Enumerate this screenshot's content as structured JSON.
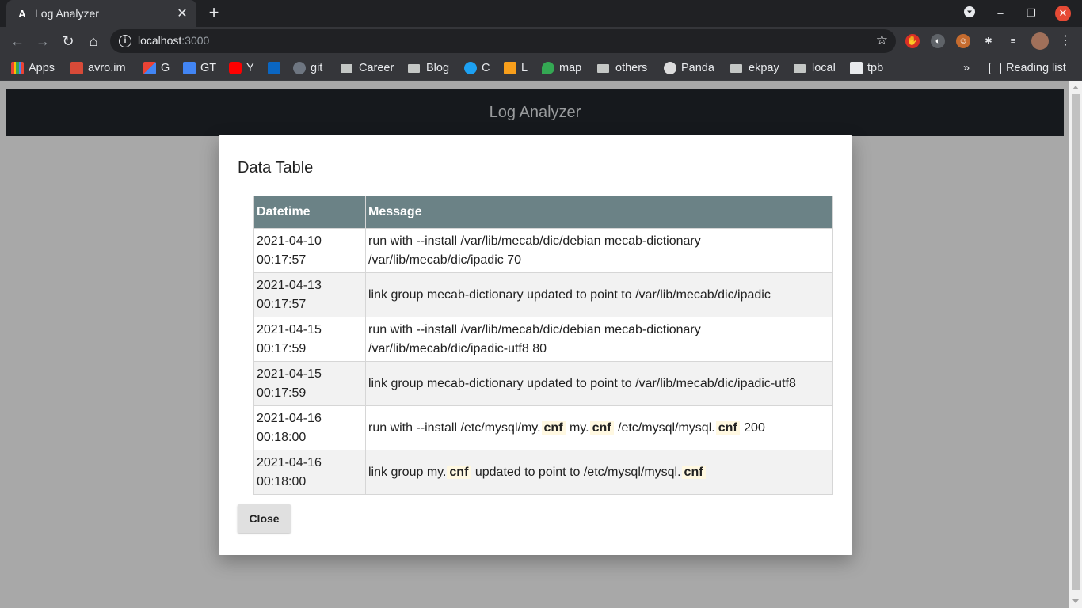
{
  "browser": {
    "tab_title": "Log Analyzer",
    "tab_favicon": "A",
    "url_host": "localhost",
    "url_port": ":3000",
    "bookmarks": [
      {
        "label": "Apps",
        "icon": "apps-grid-icon"
      },
      {
        "label": "avro.im",
        "icon": "avro-icon"
      },
      {
        "label": "G",
        "icon": "gmail-icon"
      },
      {
        "label": "GT",
        "icon": "google-translate-icon"
      },
      {
        "label": "Y",
        "icon": "youtube-icon"
      },
      {
        "label": "",
        "icon": "linkedin-icon"
      },
      {
        "label": "git",
        "icon": "github-icon"
      },
      {
        "label": "Career",
        "icon": "folder-icon"
      },
      {
        "label": "Blog",
        "icon": "folder-icon"
      },
      {
        "label": "C",
        "icon": "circle-icon"
      },
      {
        "label": "L",
        "icon": "leetcode-icon"
      },
      {
        "label": "map",
        "icon": "maps-pin-icon"
      },
      {
        "label": "others",
        "icon": "folder-icon"
      },
      {
        "label": "Panda",
        "icon": "panda-icon"
      },
      {
        "label": "ekpay",
        "icon": "folder-icon"
      },
      {
        "label": "local",
        "icon": "folder-icon"
      },
      {
        "label": "tpb",
        "icon": "tpb-icon"
      }
    ],
    "overflow_label": "»",
    "reading_list_label": "Reading list"
  },
  "app": {
    "header_title": "Log Analyzer"
  },
  "modal": {
    "title": "Data Table",
    "columns": [
      "Datetime",
      "Message"
    ],
    "rows": [
      {
        "date": "2021-04-10",
        "time": "00:17:57",
        "message": [
          {
            "text": "run with --install /var/lib/mecab/dic/debian mecab-dictionary /var/lib/mecab/dic/ipadic 70",
            "hl": false
          }
        ]
      },
      {
        "date": "2021-04-13",
        "time": "00:17:57",
        "message": [
          {
            "text": "link group mecab-dictionary updated to point to /var/lib/mecab/dic/ipadic",
            "hl": false
          }
        ]
      },
      {
        "date": "2021-04-15",
        "time": "00:17:59",
        "message": [
          {
            "text": "run with --install /var/lib/mecab/dic/debian mecab-dictionary /var/lib/mecab/dic/ipadic-utf8 80",
            "hl": false
          }
        ]
      },
      {
        "date": "2021-04-15",
        "time": "00:17:59",
        "message": [
          {
            "text": "link group mecab-dictionary updated to point to /var/lib/mecab/dic/ipadic-utf8",
            "hl": false
          }
        ]
      },
      {
        "date": "2021-04-16",
        "time": "00:18:00",
        "message": [
          {
            "text": "run with --install /etc/mysql/my.",
            "hl": false
          },
          {
            "text": "cnf",
            "hl": true
          },
          {
            "text": " my.",
            "hl": false
          },
          {
            "text": "cnf",
            "hl": true
          },
          {
            "text": " /etc/mysql/mysql.",
            "hl": false
          },
          {
            "text": "cnf",
            "hl": true
          },
          {
            "text": " 200",
            "hl": false
          }
        ]
      },
      {
        "date": "2021-04-16",
        "time": "00:18:00",
        "message": [
          {
            "text": "link group my.",
            "hl": false
          },
          {
            "text": "cnf",
            "hl": true
          },
          {
            "text": " updated to point to /etc/mysql/mysql.",
            "hl": false
          },
          {
            "text": "cnf",
            "hl": true
          }
        ]
      }
    ],
    "close_label": "Close"
  }
}
